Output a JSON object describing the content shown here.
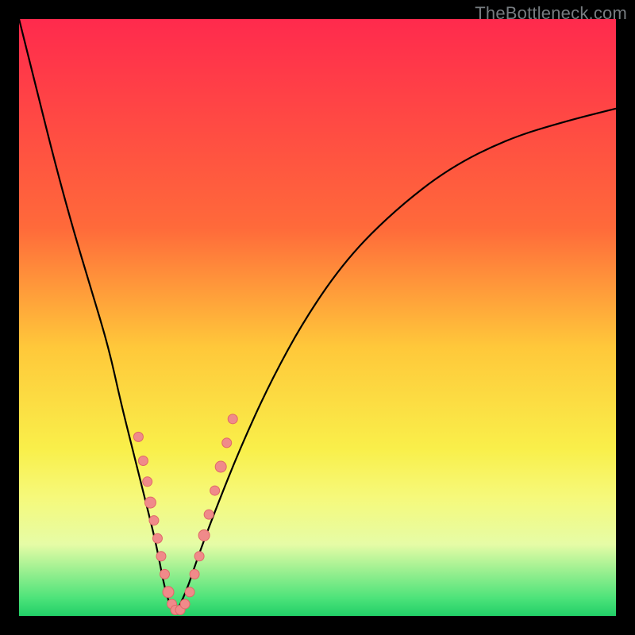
{
  "watermark": "TheBottleneck.com",
  "chart_data": {
    "type": "line",
    "title": "",
    "xlabel": "",
    "ylabel": "",
    "xlim": [
      0,
      100
    ],
    "ylim": [
      0,
      100
    ],
    "grid": false,
    "legend": false,
    "gradient_stops": [
      {
        "offset": 0,
        "color": "#ff2a4d"
      },
      {
        "offset": 35,
        "color": "#ff6a3a"
      },
      {
        "offset": 55,
        "color": "#ffc83a"
      },
      {
        "offset": 72,
        "color": "#f9ef4a"
      },
      {
        "offset": 80,
        "color": "#f6f97a"
      },
      {
        "offset": 88,
        "color": "#e6fca6"
      },
      {
        "offset": 97,
        "color": "#4de37a"
      },
      {
        "offset": 100,
        "color": "#21cf67"
      }
    ],
    "series": [
      {
        "name": "bottleneck-curve",
        "stroke": "#000000",
        "x": [
          0,
          3,
          6,
          9,
          12,
          15,
          17,
          19,
          21,
          23,
          24.5,
          26,
          28,
          30,
          33,
          37,
          42,
          48,
          55,
          63,
          72,
          82,
          92,
          100
        ],
        "values": [
          100,
          88,
          76,
          65,
          55,
          45,
          36,
          28,
          20,
          12,
          4,
          0,
          4,
          10,
          18,
          28,
          39,
          50,
          60,
          68,
          75,
          80,
          83,
          85
        ]
      }
    ],
    "markers": {
      "color": "#f08a8a",
      "stroke": "#e06868",
      "points": [
        {
          "x": 20.0,
          "y": 30.0,
          "r": 6
        },
        {
          "x": 20.8,
          "y": 26.0,
          "r": 6
        },
        {
          "x": 21.5,
          "y": 22.5,
          "r": 6
        },
        {
          "x": 22.0,
          "y": 19.0,
          "r": 7
        },
        {
          "x": 22.6,
          "y": 16.0,
          "r": 6
        },
        {
          "x": 23.2,
          "y": 13.0,
          "r": 6
        },
        {
          "x": 23.8,
          "y": 10.0,
          "r": 6
        },
        {
          "x": 24.4,
          "y": 7.0,
          "r": 6
        },
        {
          "x": 25.0,
          "y": 4.0,
          "r": 7
        },
        {
          "x": 25.6,
          "y": 2.0,
          "r": 6
        },
        {
          "x": 26.2,
          "y": 1.0,
          "r": 6
        },
        {
          "x": 27.0,
          "y": 1.0,
          "r": 6
        },
        {
          "x": 27.8,
          "y": 2.0,
          "r": 6
        },
        {
          "x": 28.6,
          "y": 4.0,
          "r": 6
        },
        {
          "x": 29.4,
          "y": 7.0,
          "r": 6
        },
        {
          "x": 30.2,
          "y": 10.0,
          "r": 6
        },
        {
          "x": 31.0,
          "y": 13.5,
          "r": 7
        },
        {
          "x": 31.8,
          "y": 17.0,
          "r": 6
        },
        {
          "x": 32.8,
          "y": 21.0,
          "r": 6
        },
        {
          "x": 33.8,
          "y": 25.0,
          "r": 7
        },
        {
          "x": 34.8,
          "y": 29.0,
          "r": 6
        },
        {
          "x": 35.8,
          "y": 33.0,
          "r": 6
        }
      ]
    }
  }
}
